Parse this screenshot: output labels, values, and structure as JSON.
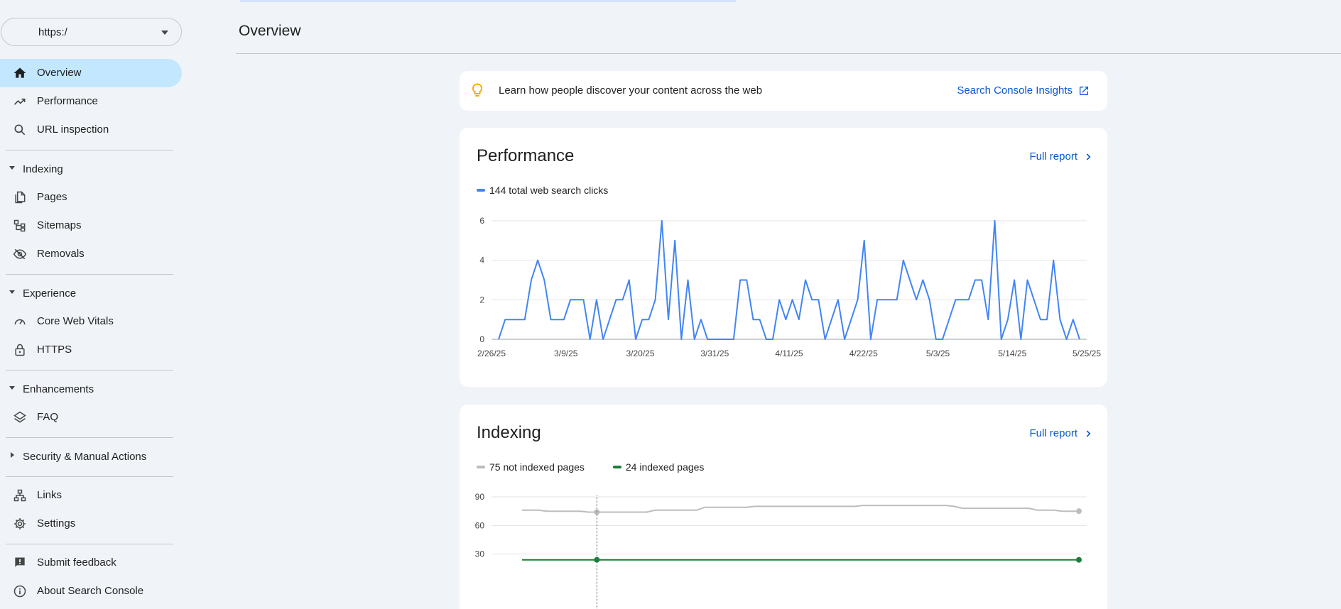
{
  "property": {
    "url": "https:/"
  },
  "nav": {
    "overview": "Overview",
    "performance": "Performance",
    "url_inspection": "URL inspection",
    "indexing": "Indexing",
    "pages": "Pages",
    "sitemaps": "Sitemaps",
    "removals": "Removals",
    "experience": "Experience",
    "core_web_vitals": "Core Web Vitals",
    "https": "HTTPS",
    "enhancements": "Enhancements",
    "faq": "FAQ",
    "security": "Security & Manual Actions",
    "links": "Links",
    "settings": "Settings",
    "submit_feedback": "Submit feedback",
    "about": "About Search Console"
  },
  "header": {
    "title": "Overview"
  },
  "insights": {
    "message": "Learn how people discover your content across the web",
    "link": "Search Console Insights"
  },
  "performance_card": {
    "title": "Performance",
    "full_report": "Full report",
    "legend": "144 total web search clicks"
  },
  "indexing_card": {
    "title": "Indexing",
    "full_report": "Full report",
    "legend_not_indexed": "75 not indexed pages",
    "legend_indexed": "24 indexed pages"
  },
  "colors": {
    "accent_blue": "#0b57d0",
    "clicks_line": "#4285f4",
    "not_indexed": "#bdbdbd",
    "indexed": "#188038",
    "active_nav": "#c2e7ff",
    "bulb": "#f9ab00"
  },
  "chart_data": [
    {
      "type": "line",
      "series": [
        {
          "name": "144 total web search clicks",
          "values": [
            0,
            1,
            1,
            1,
            1,
            3,
            4,
            3,
            1,
            1,
            1,
            2,
            2,
            2,
            0,
            2,
            0,
            1,
            2,
            2,
            3,
            0,
            1,
            1,
            2,
            6,
            1,
            5,
            0,
            3,
            0,
            1,
            0,
            0,
            0,
            0,
            0,
            3,
            3,
            1,
            1,
            0,
            0,
            2,
            1,
            2,
            1,
            3,
            2,
            2,
            0,
            1,
            2,
            0,
            1,
            2,
            5,
            0,
            2,
            2,
            2,
            2,
            4,
            3,
            2,
            3,
            2,
            0,
            0,
            1,
            2,
            2,
            2,
            3,
            3,
            1,
            6,
            0,
            1,
            3,
            0,
            3,
            2,
            1,
            1,
            4,
            1,
            0,
            1,
            0
          ]
        }
      ],
      "x_tick_labels": [
        "2/26/25",
        "3/9/25",
        "3/20/25",
        "3/31/25",
        "4/11/25",
        "4/22/25",
        "5/3/25",
        "5/14/25",
        "5/25/25"
      ],
      "y_ticks": [
        0,
        2,
        4,
        6
      ],
      "ylim": [
        0,
        6
      ],
      "grid": true
    },
    {
      "type": "line",
      "series": [
        {
          "name": "75 not indexed pages",
          "values": [
            76,
            76,
            76,
            75,
            75,
            75,
            75,
            75,
            74,
            74,
            74,
            74,
            74,
            74,
            74,
            74,
            76,
            76,
            76,
            76,
            76,
            76,
            79,
            79,
            79,
            79,
            79,
            79,
            80,
            80,
            80,
            80,
            80,
            80,
            80,
            80,
            80,
            80,
            80,
            80,
            80,
            81,
            81,
            81,
            81,
            81,
            81,
            81,
            81,
            81,
            81,
            81,
            80,
            78,
            78,
            78,
            78,
            78,
            78,
            78,
            78,
            78,
            76,
            76,
            76,
            75,
            75,
            75
          ]
        },
        {
          "name": "24 indexed pages",
          "values": [
            24,
            24,
            24,
            24,
            24,
            24,
            24,
            24,
            24,
            24,
            24,
            24,
            24,
            24,
            24,
            24,
            24,
            24,
            24,
            24,
            24,
            24,
            24,
            24,
            24,
            24,
            24,
            24,
            24,
            24,
            24,
            24,
            24,
            24,
            24,
            24,
            24,
            24,
            24,
            24,
            24,
            24,
            24,
            24,
            24,
            24,
            24,
            24,
            24,
            24,
            24,
            24,
            24,
            24,
            24,
            24,
            24,
            24,
            24,
            24,
            24,
            24,
            24,
            24,
            24,
            24,
            24,
            24
          ]
        }
      ],
      "y_ticks": [
        30,
        60,
        90
      ],
      "ylim": [
        0,
        90
      ],
      "grid": true
    }
  ]
}
